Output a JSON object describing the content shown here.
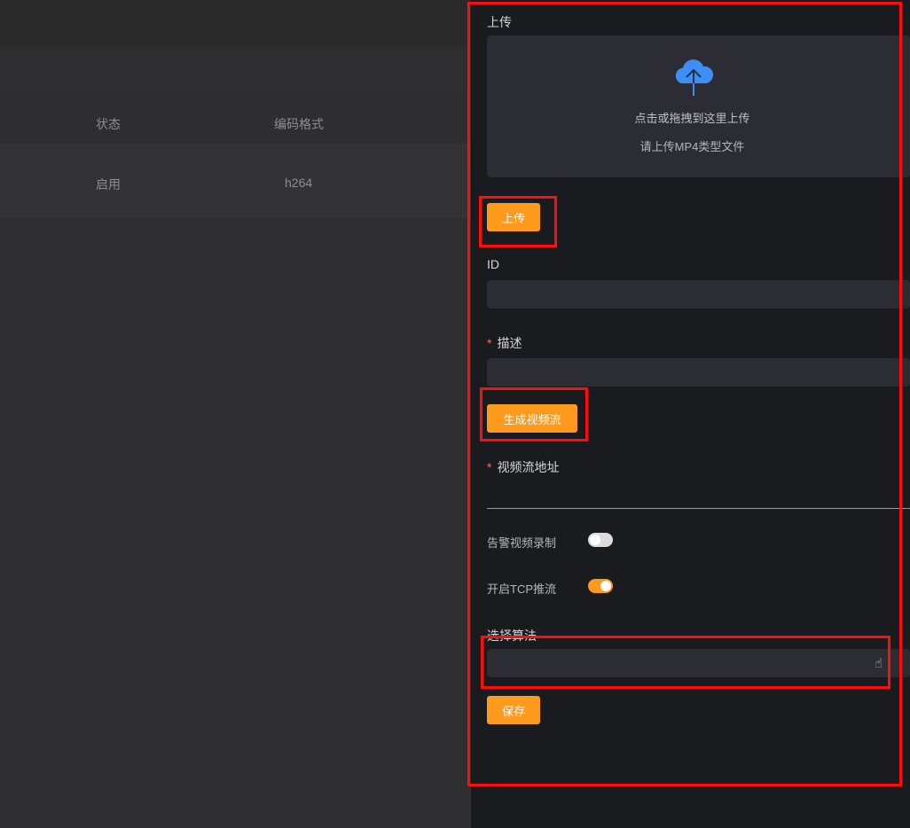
{
  "table": {
    "headers": [
      "状态",
      "编码格式"
    ],
    "rows": [
      [
        "启用",
        "h264"
      ]
    ]
  },
  "drawer": {
    "upload_label": "上传",
    "upload_hint": "点击或拖拽到这里上传",
    "upload_tip": "请上传MP4类型文件",
    "upload_button": "上传",
    "id_label": "ID",
    "id_value": "",
    "desc_label": "描述",
    "desc_value": "",
    "generate_button": "生成视频流",
    "stream_label": "视频流地址",
    "stream_value": "",
    "alarm_record_label": "告警视频录制",
    "alarm_record_on": false,
    "tcp_label": "开启TCP推流",
    "tcp_on": true,
    "algo_label": "选择算法",
    "algo_value": "",
    "save_button": "保存"
  },
  "colors": {
    "accent": "#ff9a1c",
    "required": "#f56c6c",
    "upload_icon": "#3d8ff5",
    "annotation": "#ff0d0d"
  }
}
